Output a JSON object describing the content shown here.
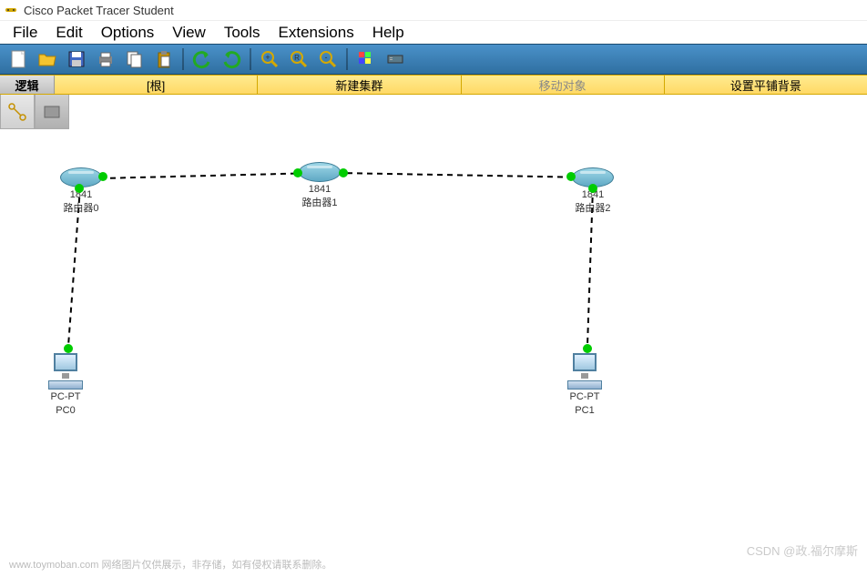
{
  "title": "Cisco Packet Tracer Student",
  "menu": [
    "File",
    "Edit",
    "Options",
    "View",
    "Tools",
    "Extensions",
    "Help"
  ],
  "toolbar_icons": [
    "new",
    "open",
    "save",
    "print",
    "copy",
    "paste",
    "undo",
    "redo",
    "zoom-in",
    "zoom-reset",
    "zoom-out",
    "palette",
    "device"
  ],
  "yellow_bar": {
    "logical": "逻辑",
    "root": "[根]",
    "new_cluster": "新建集群",
    "move_object": "移动对象",
    "set_bg": "设置平铺背景"
  },
  "devices": {
    "router0": {
      "model": "1841",
      "name": "路由器0"
    },
    "router1": {
      "model": "1841",
      "name": "路由器1"
    },
    "router2": {
      "model": "1841",
      "name": "路由器2"
    },
    "pc0": {
      "type": "PC-PT",
      "name": "PC0"
    },
    "pc1": {
      "type": "PC-PT",
      "name": "PC1"
    }
  },
  "watermarks": {
    "br": "CSDN @政.福尔摩斯",
    "bl": "www.toymoban.com 网络图片仅供展示，非存储，如有侵权请联系删除。"
  }
}
